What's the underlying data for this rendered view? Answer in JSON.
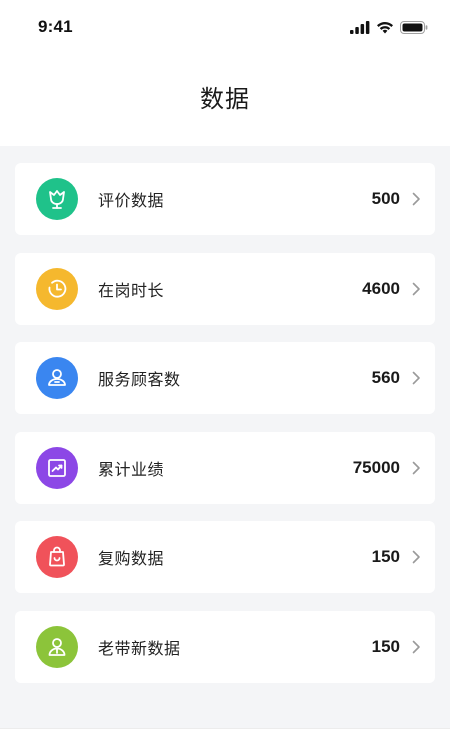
{
  "status_bar": {
    "time": "9:41"
  },
  "header": {
    "title": "数据"
  },
  "items": [
    {
      "label": "评价数据",
      "value": "500",
      "icon": "flower-icon",
      "color": "#1fc28a"
    },
    {
      "label": "在岗时长",
      "value": "4600",
      "icon": "clock-icon",
      "color": "#f5b82e"
    },
    {
      "label": "服务顾客数",
      "value": "560",
      "icon": "customer-icon",
      "color": "#3a86f0"
    },
    {
      "label": "累计业绩",
      "value": "75000",
      "icon": "trend-chart-icon",
      "color": "#8c47e6"
    },
    {
      "label": "复购数据",
      "value": "150",
      "icon": "shopping-bag-icon",
      "color": "#f0525a"
    },
    {
      "label": "老带新数据",
      "value": "150",
      "icon": "user-badge-icon",
      "color": "#8cc43a"
    }
  ]
}
